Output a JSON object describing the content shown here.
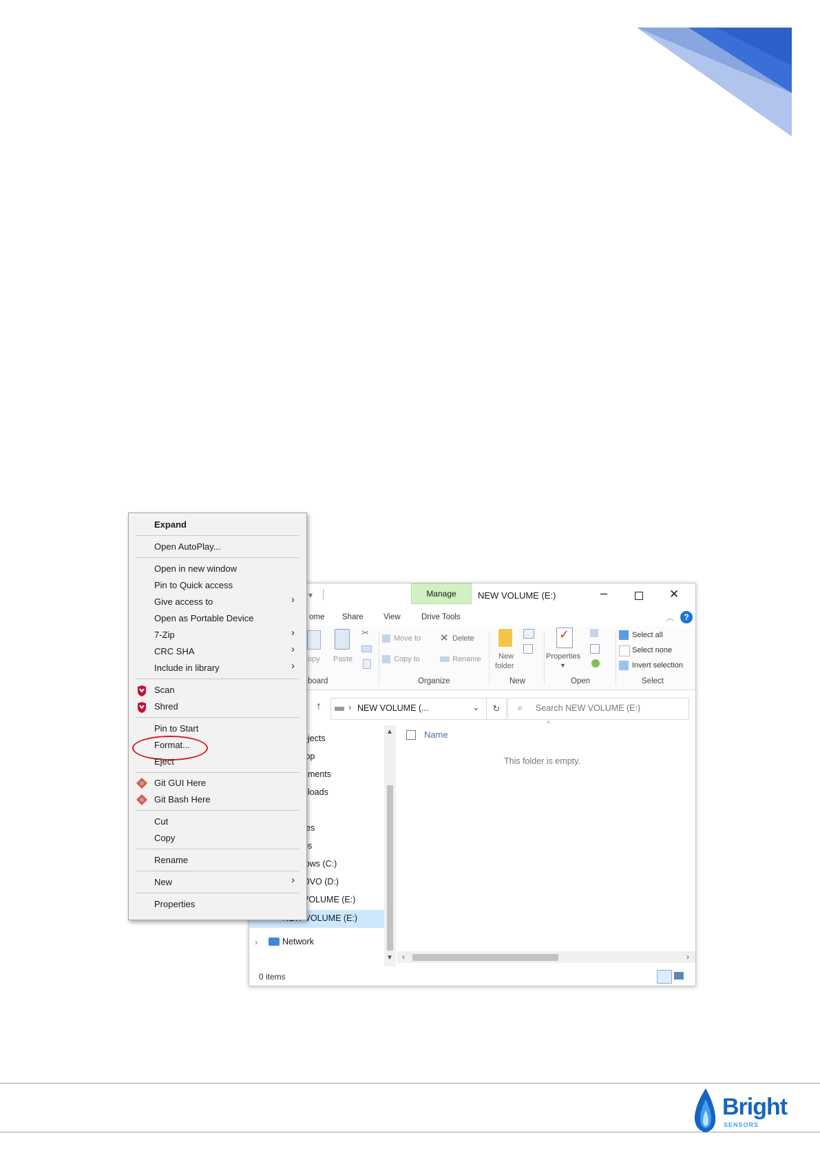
{
  "explorer": {
    "title": "NEW VOLUME (E:)",
    "manage_tab": "Manage",
    "drive_tools_tab": "Drive Tools",
    "quick_access_divider": "│",
    "ribbon_tabs": [
      "ome",
      "Share",
      "View"
    ],
    "ribbon": {
      "copy": "opy",
      "paste": "Paste",
      "move_to": "Move to",
      "copy_to": "Copy to",
      "delete": "Delete",
      "rename": "Rename",
      "new_folder_line1": "New",
      "new_folder_line2": "folder",
      "properties": "Properties",
      "select_all": "Select all",
      "select_none": "Select none",
      "invert_selection": "Invert selection",
      "groups": {
        "clipboard": "board",
        "organize": "Organize",
        "new": "New",
        "open": "Open",
        "select": "Select"
      }
    },
    "address_text": "NEW VOLUME (...",
    "search_placeholder": "Search NEW VOLUME (E:)",
    "nav_items": [
      "bjects",
      "top",
      "uments",
      "nloads",
      "c",
      "res",
      "os",
      "lows (C:)",
      "OVO (D:)",
      "VOLUME (E:)",
      "NEW VOLUME (E:)",
      "Network"
    ],
    "column_name": "Name",
    "empty_message": "This folder is empty.",
    "status": "0 items"
  },
  "context_menu": {
    "items": [
      {
        "label": "Expand",
        "bold": true
      },
      {
        "label": "Open AutoPlay..."
      },
      {
        "label": "Open in new window"
      },
      {
        "label": "Pin to Quick access"
      },
      {
        "label": "Give access to",
        "submenu": true
      },
      {
        "label": "Open as Portable Device"
      },
      {
        "label": "7-Zip",
        "submenu": true
      },
      {
        "label": "CRC SHA",
        "submenu": true
      },
      {
        "label": "Include in library",
        "submenu": true
      },
      {
        "label": "Scan",
        "icon": "mcafee-shield-icon"
      },
      {
        "label": "Shred",
        "icon": "mcafee-shield-icon"
      },
      {
        "label": "Pin to Start"
      },
      {
        "label": "Format...",
        "highlighted": true
      },
      {
        "label": "Eject"
      },
      {
        "label": "Git GUI Here",
        "icon": "git-icon"
      },
      {
        "label": "Git Bash Here",
        "icon": "git-icon"
      },
      {
        "label": "Cut"
      },
      {
        "label": "Copy"
      },
      {
        "label": "Rename"
      },
      {
        "label": "New",
        "submenu": true
      },
      {
        "label": "Properties"
      }
    ]
  },
  "footer": {
    "brand": "Bright",
    "brand_sub": "SENSORS"
  },
  "colors": {
    "accent_blue": "#3a6fd8",
    "highlight_red": "#d42020",
    "manage_green": "#d2f1c3",
    "selection_blue": "#cce8ff"
  }
}
